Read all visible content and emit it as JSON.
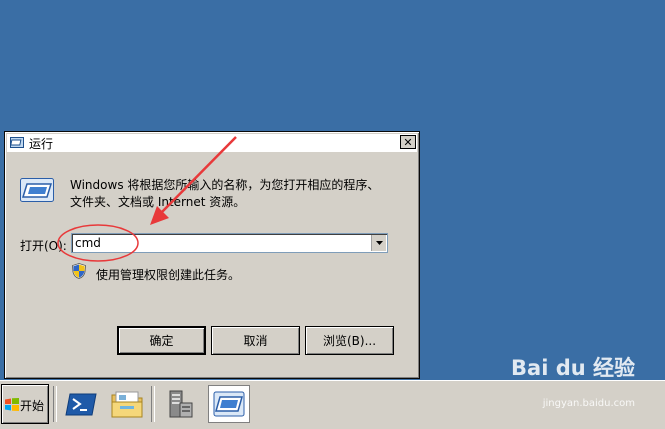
{
  "dialog": {
    "title": "运行",
    "close_label": "✕",
    "description_line1": "Windows 将根据您所输入的名称，为您打开相应的程序、",
    "description_line2": "文件夹、文档或 Internet 资源。",
    "open_label": "打开(O):",
    "command_value": "cmd",
    "admin_note": "使用管理权限创建此任务。",
    "ok_label": "确定",
    "cancel_label": "取消",
    "browse_label": "浏览(B)..."
  },
  "taskbar": {
    "start_label": "开始",
    "buttons": [
      {
        "icon": "powershell-icon"
      },
      {
        "icon": "explorer-folder-icon"
      },
      {
        "icon": "server-manager-icon"
      },
      {
        "icon": "run-icon",
        "active": true
      }
    ]
  },
  "watermark": {
    "brand": "Bai du 经验",
    "url": "jingyan.baidu.com"
  },
  "annotation": {
    "arrow_color": "#e8393a",
    "circle_color": "#e8393a"
  },
  "colors": {
    "desktop": "#3a6ea5",
    "dialog_face": "#d4d0c8"
  }
}
